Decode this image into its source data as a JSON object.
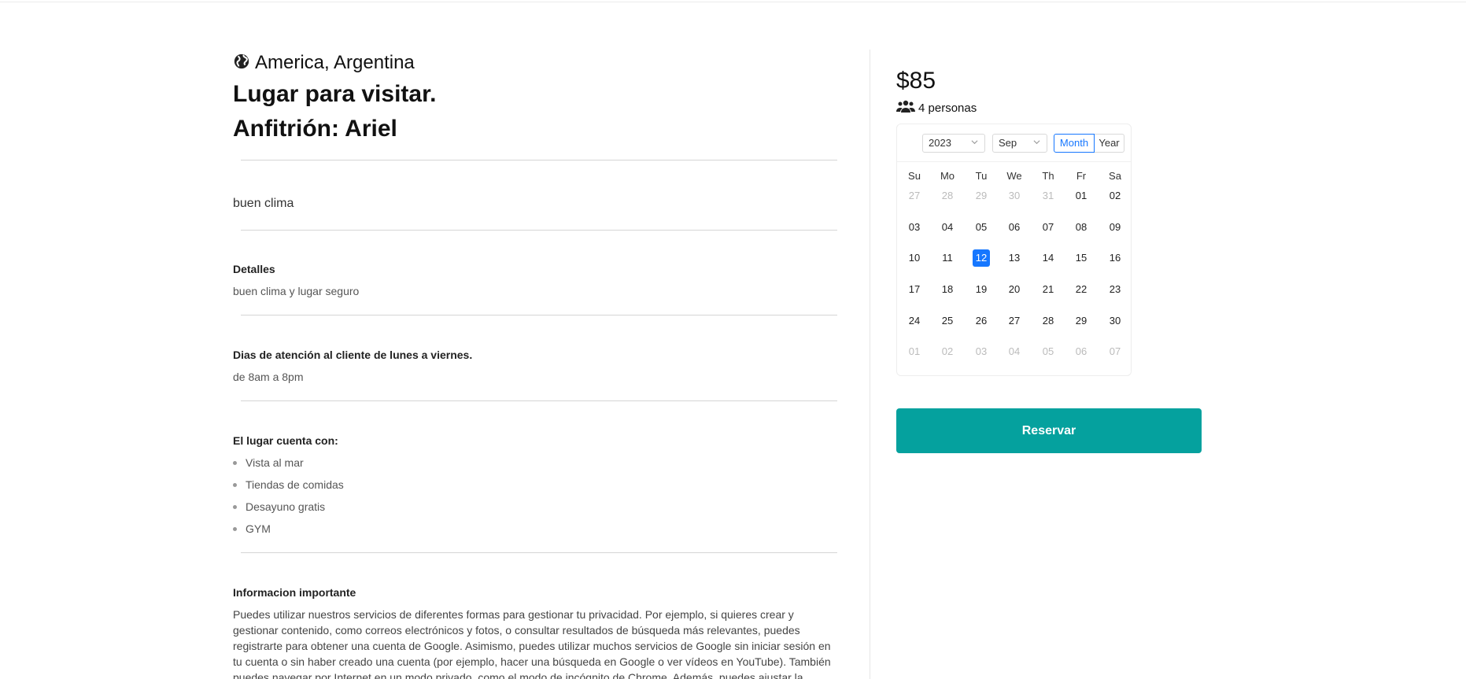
{
  "listing": {
    "location": "America, Argentina",
    "title": "Lugar para visitar.",
    "host": "Anfitrión: Ariel",
    "short_description": "buen clima",
    "details_title": "Detalles",
    "details_text": "buen clima y lugar seguro",
    "hours_title": "Dias de atención al cliente de lunes a viernes.",
    "hours_text": "de 8am a 8pm",
    "amenities_title": "El lugar cuenta con:",
    "amenities": [
      "Vista al mar",
      "Tiendas de comidas",
      "Desayuno gratis",
      "GYM"
    ],
    "info_title": "Informacion importante",
    "info_text": "Puedes utilizar nuestros servicios de diferentes formas para gestionar tu privacidad. Por ejemplo, si quieres crear y gestionar contenido, como correos electrónicos y fotos, o consultar resultados de búsqueda más relevantes, puedes registrarte para obtener una cuenta de Google. Asimismo, puedes utilizar muchos servicios de Google sin iniciar sesión en tu cuenta o sin haber creado una cuenta (por ejemplo, hacer una búsqueda en Google o ver vídeos en YouTube). También puedes navegar por Internet en un modo privado, como el modo de incógnito de Chrome. Además, puedes ajustar la configuración de"
  },
  "booking": {
    "price": "$85",
    "capacity": "4 personas",
    "reserve_label": "Reservar"
  },
  "calendar": {
    "year": "2023",
    "month": "Sep",
    "mode_month": "Month",
    "mode_year": "Year",
    "weekdays": [
      "Su",
      "Mo",
      "Tu",
      "We",
      "Th",
      "Fr",
      "Sa"
    ],
    "weeks": [
      [
        "27",
        "28",
        "29",
        "30",
        "31",
        "01",
        "02"
      ],
      [
        "03",
        "04",
        "05",
        "06",
        "07",
        "08",
        "09"
      ],
      [
        "10",
        "11",
        "12",
        "13",
        "14",
        "15",
        "16"
      ],
      [
        "17",
        "18",
        "19",
        "20",
        "21",
        "22",
        "23"
      ],
      [
        "24",
        "25",
        "26",
        "27",
        "28",
        "29",
        "30"
      ],
      [
        "01",
        "02",
        "03",
        "04",
        "05",
        "06",
        "07"
      ]
    ],
    "selected_day": "12",
    "accent_color": "#1677ff"
  },
  "colors": {
    "button": "#05a19e"
  },
  "icons": {
    "location": "globe-icon",
    "capacity": "people-icon"
  }
}
